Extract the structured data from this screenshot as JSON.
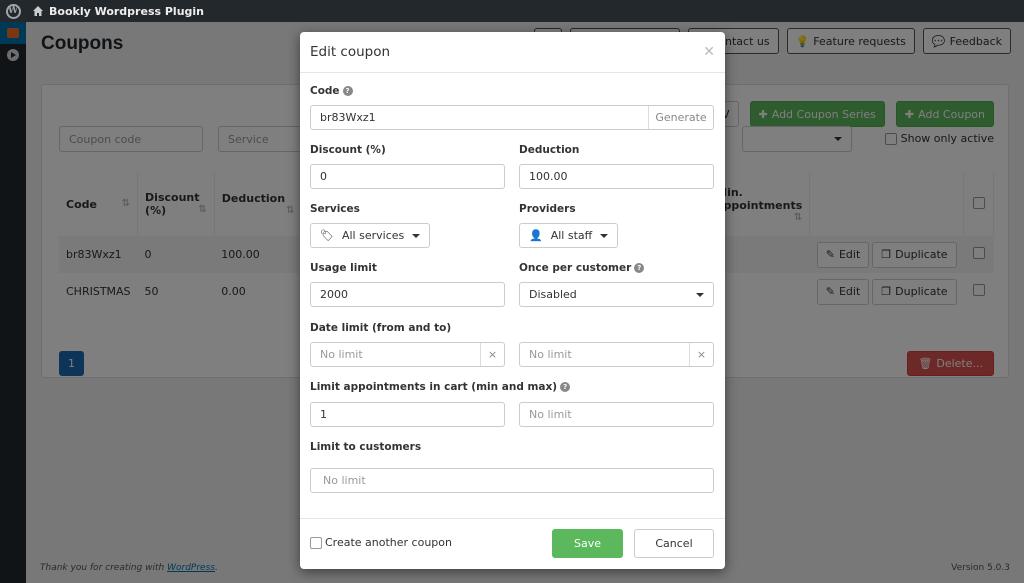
{
  "adminbar": {
    "site_name": "Bookly Wordpress Plugin"
  },
  "page": {
    "title": "Coupons"
  },
  "top_buttons": [
    {
      "label": "",
      "icon": "blank"
    },
    {
      "label": "",
      "icon": "blank"
    },
    {
      "label": "Contact us",
      "icon": "envelope-icon"
    },
    {
      "label": "Feature requests",
      "icon": "lightbulb-icon"
    },
    {
      "label": "Feedback",
      "icon": "comment-icon"
    }
  ],
  "panel_actions": {
    "export_label": "CSV",
    "add_series_label": "Add Coupon Series",
    "add_coupon_label": "Add Coupon"
  },
  "filters": {
    "coupon_code_placeholder": "Coupon code",
    "service_placeholder": "Service",
    "show_only_active_label": "Show only active"
  },
  "table": {
    "columns": [
      "Code",
      "Discount (%)",
      "Deduction",
      "Min. appointments"
    ],
    "rows": [
      {
        "code": "br83Wxz1",
        "discount": "0",
        "deduction": "100.00"
      },
      {
        "code": "CHRISTMAS",
        "discount": "50",
        "deduction": "0.00"
      }
    ],
    "edit_label": "Edit",
    "duplicate_label": "Duplicate"
  },
  "pagination": {
    "current_page": "1"
  },
  "delete_label": "Delete...",
  "footer": {
    "thanks_prefix": "Thank you for creating with ",
    "thanks_link": "WordPress",
    "thanks_suffix": ".",
    "version": "Version 5.0.3"
  },
  "modal": {
    "title": "Edit coupon",
    "code_label": "Code",
    "code_value": "br83Wxz1",
    "generate_label": "Generate",
    "discount_label": "Discount (%)",
    "discount_value": "0",
    "deduction_label": "Deduction",
    "deduction_value": "100.00",
    "services_label": "Services",
    "services_value": "All services",
    "providers_label": "Providers",
    "providers_value": "All staff",
    "usage_limit_label": "Usage limit",
    "usage_limit_value": "2000",
    "once_per_customer_label": "Once per customer",
    "once_per_customer_value": "Disabled",
    "date_limit_label": "Date limit (from and to)",
    "date_from_placeholder": "No limit",
    "date_to_placeholder": "No limit",
    "cart_limit_label": "Limit appointments in cart (min and max)",
    "cart_min_value": "1",
    "cart_max_placeholder": "No limit",
    "customers_label": "Limit to customers",
    "customers_placeholder": "No limit",
    "create_another_label": "Create another coupon",
    "save_label": "Save",
    "cancel_label": "Cancel"
  }
}
